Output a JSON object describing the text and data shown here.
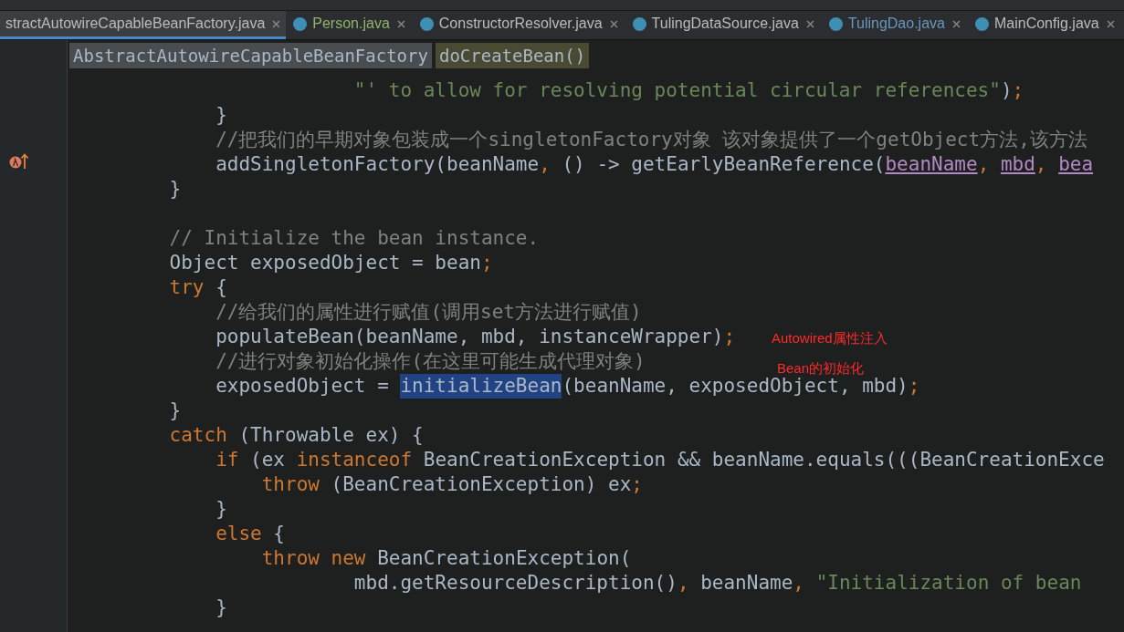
{
  "tabs": [
    {
      "label": "stractAutowireCapableBeanFactory.java",
      "selected": true,
      "color": "#bbbbbb"
    },
    {
      "label": "Person.java",
      "selected": false,
      "color": "#8fb46a"
    },
    {
      "label": "ConstructorResolver.java",
      "selected": false,
      "color": "#bbbbbb"
    },
    {
      "label": "TulingDataSource.java",
      "selected": false,
      "color": "#bbbbbb"
    },
    {
      "label": "TulingDao.java",
      "selected": false,
      "color": "#6897bb"
    },
    {
      "label": "MainConfig.java",
      "selected": false,
      "color": "#bbbbbb"
    }
  ],
  "breadcrumbs": [
    {
      "label": "AbstractAutowireCapableBeanFactory",
      "kind": "class"
    },
    {
      "label": "doCreateBean()",
      "kind": "method"
    }
  ],
  "code_lines": [
    {
      "tokens": [
        {
          "text": "                    \"' to allow for resolving potential circular references\"",
          "kind": "string"
        },
        {
          "text": ")",
          "kind": "plain"
        },
        {
          "text": ";",
          "kind": "punct"
        }
      ]
    },
    {
      "tokens": [
        {
          "text": "        }",
          "kind": "plain"
        }
      ]
    },
    {
      "tokens": [
        {
          "text": "        //把我们的早期对象包装成一个singletonFactory对象 该对象提供了一个getObject方法,该方法",
          "kind": "comment"
        }
      ]
    },
    {
      "gutter_icon": true,
      "tokens": [
        {
          "text": "        addSingletonFactory(beanName",
          "kind": "plain"
        },
        {
          "text": ", ",
          "kind": "punct"
        },
        {
          "text": "() -> getEarlyBeanReference(",
          "kind": "plain"
        },
        {
          "text": "beanName",
          "kind": "param"
        },
        {
          "text": ", ",
          "kind": "punct"
        },
        {
          "text": "mbd",
          "kind": "param"
        },
        {
          "text": ", ",
          "kind": "punct"
        },
        {
          "text": "bea",
          "kind": "param"
        }
      ]
    },
    {
      "tokens": [
        {
          "text": "    }",
          "kind": "plain"
        }
      ]
    },
    {
      "blank_line_before": true,
      "tokens": [
        {
          "text": "    // Initialize the bean instance.",
          "kind": "comment"
        }
      ]
    },
    {
      "tokens": [
        {
          "text": "    Object exposedObject = bean",
          "kind": "plain"
        },
        {
          "text": ";",
          "kind": "punct"
        }
      ]
    },
    {
      "tokens": [
        {
          "text": "    try",
          "kind": "keyword"
        },
        {
          "text": " {",
          "kind": "plain"
        }
      ]
    },
    {
      "tokens": [
        {
          "text": "        //给我们的属性进行赋值(调用set方法进行赋值)",
          "kind": "comment"
        }
      ]
    },
    {
      "note": "Autowired属性注入",
      "tokens": [
        {
          "text": "        populateBean(beanName, mbd, instanceWrapper)",
          "kind": "plain"
        },
        {
          "text": ";",
          "kind": "punct"
        }
      ]
    },
    {
      "tokens": [
        {
          "text": "        //进行对象初始化操作(在这里可能生成代理对象)",
          "kind": "comment"
        }
      ]
    },
    {
      "note": "Bean的初始化",
      "tokens": [
        {
          "text": "        exposedObject = ",
          "kind": "plain"
        },
        {
          "text": "initializeBean",
          "kind": "selected"
        },
        {
          "text": "(beanName, exposedObject, mbd)",
          "kind": "plain"
        },
        {
          "text": ";",
          "kind": "punct"
        }
      ]
    },
    {
      "tokens": [
        {
          "text": "    }",
          "kind": "plain"
        }
      ]
    },
    {
      "tokens": [
        {
          "text": "    catch",
          "kind": "keyword"
        },
        {
          "text": " (Throwable ex) {",
          "kind": "plain"
        }
      ]
    },
    {
      "tokens": [
        {
          "text": "        if",
          "kind": "keyword"
        },
        {
          "text": " (ex ",
          "kind": "plain"
        },
        {
          "text": "instanceof",
          "kind": "keyword"
        },
        {
          "text": " BeanCreationException && beanName.equals(((BeanCreationExce",
          "kind": "plain"
        }
      ]
    },
    {
      "tokens": [
        {
          "text": "            throw",
          "kind": "keyword"
        },
        {
          "text": " (BeanCreationException) ex",
          "kind": "plain"
        },
        {
          "text": ";",
          "kind": "punct"
        }
      ]
    },
    {
      "tokens": [
        {
          "text": "        }",
          "kind": "plain"
        }
      ]
    },
    {
      "tokens": [
        {
          "text": "        else",
          "kind": "keyword"
        },
        {
          "text": " {",
          "kind": "plain"
        }
      ]
    },
    {
      "tokens": [
        {
          "text": "            throw new",
          "kind": "keyword"
        },
        {
          "text": " BeanCreationException(",
          "kind": "plain"
        }
      ]
    },
    {
      "tokens": [
        {
          "text": "                    mbd.getResourceDescription()",
          "kind": "plain"
        },
        {
          "text": ", ",
          "kind": "punct"
        },
        {
          "text": "beanName",
          "kind": "plain"
        },
        {
          "text": ", ",
          "kind": "punct"
        },
        {
          "text": "\"Initialization of bean",
          "kind": "string"
        }
      ]
    },
    {
      "tokens": [
        {
          "text": "        }",
          "kind": "plain"
        }
      ]
    }
  ]
}
